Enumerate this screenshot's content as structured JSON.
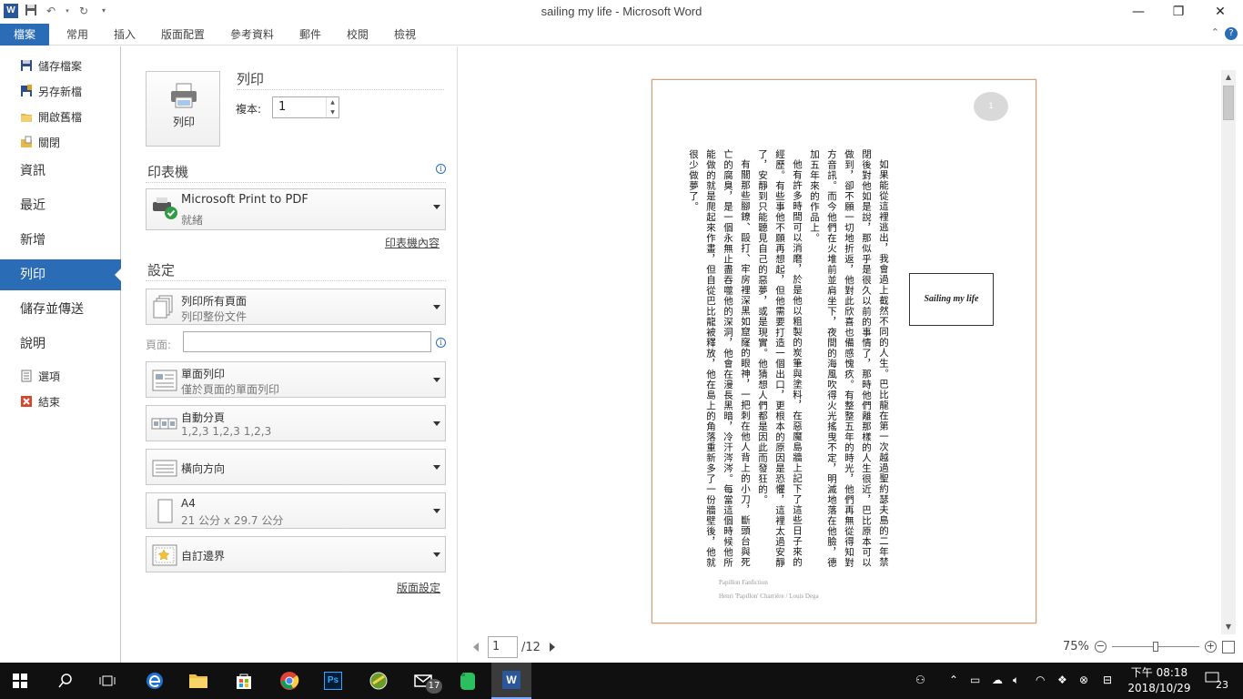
{
  "window": {
    "title": "sailing my life  -  Microsoft Word",
    "minimize_glyph": "—",
    "restore_glyph": "❐",
    "close_glyph": "✕"
  },
  "ribbon": {
    "tabs": [
      "檔案",
      "常用",
      "插入",
      "版面配置",
      "參考資料",
      "郵件",
      "校閱",
      "檢視"
    ],
    "active_tab": "檔案",
    "accent_color": "#2b6cb6"
  },
  "nav": {
    "small_items": [
      {
        "label": "儲存檔案",
        "icon": "save-icon"
      },
      {
        "label": "另存新檔",
        "icon": "save-as-icon"
      },
      {
        "label": "開啟舊檔",
        "icon": "open-folder-icon"
      },
      {
        "label": "關閉",
        "icon": "close-doc-icon"
      }
    ],
    "big_items": [
      "資訊",
      "最近",
      "新增",
      "列印",
      "儲存並傳送",
      "說明"
    ],
    "active": "列印",
    "bottom_items": [
      {
        "label": "選項",
        "icon": "options-icon"
      },
      {
        "label": "結束",
        "icon": "exit-icon"
      }
    ]
  },
  "print": {
    "button_label": "列印",
    "section_title": "列印",
    "copies_label": "複本:",
    "copies_value": "1",
    "printer_section": "印表機",
    "printer_name": "Microsoft Print to PDF",
    "printer_status": "就緒",
    "printer_props_link": "印表機內容",
    "settings_section": "設定",
    "pages_label": "頁面:",
    "pages_value": "",
    "settings": [
      {
        "t1": "列印所有頁面",
        "t2": "列印整份文件"
      },
      {
        "t1": "單面列印",
        "t2": "僅於頁面的單面列印"
      },
      {
        "t1": "自動分頁",
        "t2": "1,2,3    1,2,3    1,2,3"
      },
      {
        "t1": "橫向方向",
        "t2": ""
      },
      {
        "t1": "A4",
        "t2": "21 公分 x 29.7 公分"
      },
      {
        "t1": "自訂邊界",
        "t2": ""
      }
    ],
    "page_setup_link": "版面設定"
  },
  "preview": {
    "page_number_badge": "1",
    "title_box": "Sailing my life",
    "paragraphs": [
      "如果能從這裡逃出，我會過上截然不同的人生。巴比龍在第一次越過聖約瑟夫島的二年禁閉後對他如是說，那似乎是很久以前的事情了，那時他們離那樣的人生很近，巴比原本可以做到，卻不願一切地折返，他對此欣喜也備感愧疚。有整整五年的時光，他們再無從得知對方音訊。而今他們在火堆前並肩坐下，夜間的海風吹得火光搖曳不定，明滅地落在他臉，德加五年來的作品上。",
      "他有許多時間可以消磨，於是他以粗製的炭筆與塗料，在惡魔島牆上記下了這些日子來的經歷。有些事他不願再想起，但他需要打造一個出口，更根本的原因是恐懼，這裡太過安靜了，安靜到只能聽見自己的惡夢，或是現實。他猜想人們都是因此而發狂的。",
      "有關那些腳鐐、毆打、牢房裡深黑如窟窿的眼神，一把刺在他人背上的小刀，斷頭台與死亡的腐臭，是一個永無止盡吞噬他的深洞，他會在漫長黑暗，冷汗涔涔。每當這個時候他所能做的就是爬起來作畫，但自從巴比龍被釋放，他在島上的角落重新多了一份牆壁後，他就很少做夢了。"
    ],
    "footer_line1": "Papillon Fanfiction",
    "footer_line2": "Henri 'Papillon' Charrière / Louis Dega",
    "page_input": "1",
    "page_total": "/12",
    "zoom": "75%",
    "zoom_level": 0.5
  },
  "taskbar": {
    "clock_time": "下午 08:18",
    "clock_date": "2018/10/29",
    "mail_badge": "17",
    "notification_count": "23",
    "apps": [
      "start-icon",
      "search-icon",
      "task-view-icon",
      "edge-icon",
      "file-explorer-icon",
      "store-icon",
      "chrome-icon",
      "photoshop-icon",
      "game-icon",
      "mail-icon",
      "evernote-icon",
      "word-icon"
    ]
  }
}
